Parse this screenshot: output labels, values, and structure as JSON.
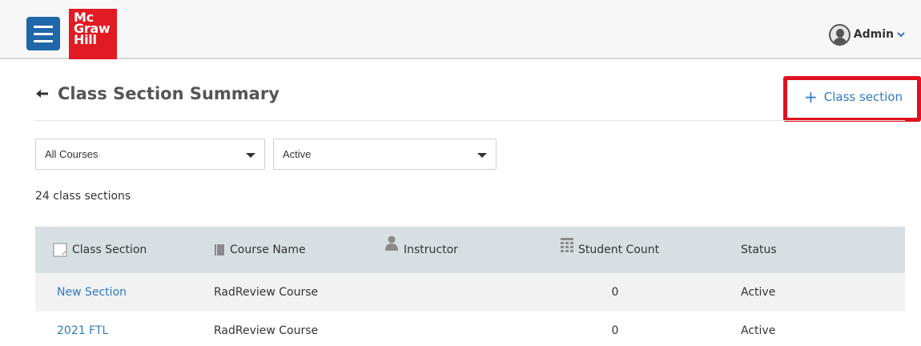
{
  "header": {
    "logo_lines": [
      "Mc",
      "Graw",
      "Hill"
    ],
    "user_name": "Admin"
  },
  "page": {
    "title": "Class Section Summary",
    "add_button_label": "Class section"
  },
  "filters": {
    "course": "All Courses",
    "status": "Active"
  },
  "summary": {
    "count_text": "24 class sections"
  },
  "table": {
    "columns": [
      "Class Section",
      "Course Name",
      "Instructor",
      "Student Count",
      "Status"
    ],
    "rows": [
      {
        "class_section": "New Section",
        "course_name": "RadReview Course",
        "instructor": "",
        "student_count": "0",
        "status": "Active"
      },
      {
        "class_section": "2021 FTL",
        "course_name": "RadReview Course",
        "instructor": "",
        "student_count": "0",
        "status": "Active"
      }
    ]
  },
  "colors": {
    "primary_blue": "#1f67a8",
    "link_blue": "#2f7ac2",
    "brand_red": "#e21a23",
    "highlight_red": "#e0101f",
    "table_header_bg": "#d8dfe3"
  },
  "icons": {
    "menu": "hamburger-icon",
    "back": "back-arrow-icon",
    "add": "plus-icon",
    "user": "user-avatar-icon",
    "dropdown": "chevron-down-icon",
    "class_section": "checkbox-icon",
    "course_name": "book-icon",
    "instructor": "person-icon",
    "student_count": "grid-icon"
  }
}
